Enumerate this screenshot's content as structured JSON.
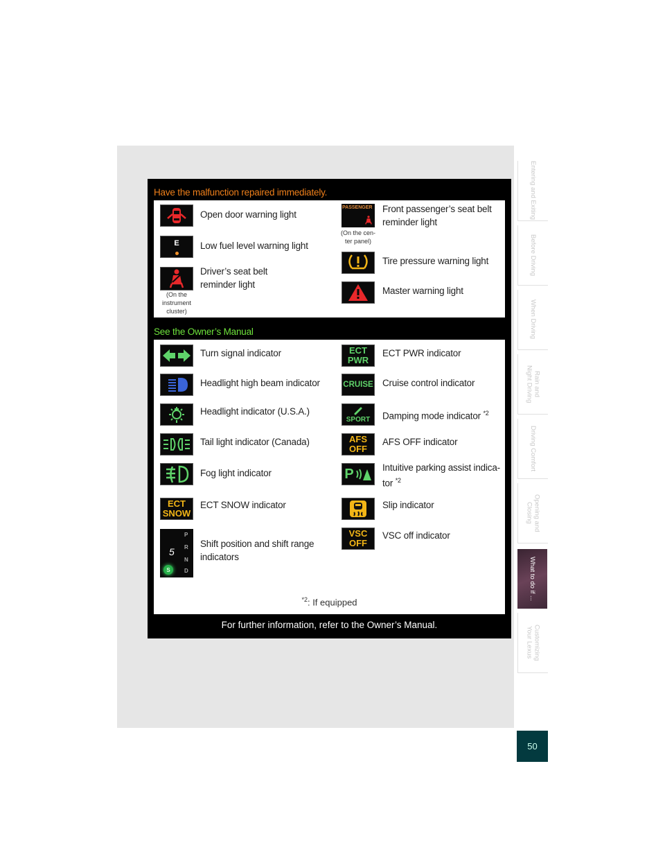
{
  "section1": {
    "title": "Have the malfunction repaired immediately.",
    "title_color": "#ee7f1a",
    "items_left": [
      {
        "icon": "open-door-icon",
        "label": "Open door warning light",
        "color": "#e8282a"
      },
      {
        "icon": "low-fuel-icon",
        "label": "Low fuel level warning light",
        "icon_text": "E",
        "color": "#f0902a"
      },
      {
        "icon": "seat-belt-icon",
        "label_line1": "Driver’s seat belt",
        "label_line2": "reminder light",
        "note_line1": "(On the",
        "note_line2": "instrument",
        "note_line3": "cluster)",
        "color": "#e8282a"
      }
    ],
    "items_right": [
      {
        "icon": "passenger-seat-belt-icon",
        "icon_text": "PASSENGER",
        "label_line1": "Front passenger’s seat belt",
        "label_line2": "reminder light",
        "note_line1": "(On the cen-",
        "note_line2": "ter panel)",
        "color": "#e8282a"
      },
      {
        "icon": "tire-pressure-icon",
        "label": "Tire pressure warning light",
        "color": "#f2b516"
      },
      {
        "icon": "master-warning-icon",
        "label": "Master warning light",
        "color": "#e8282a"
      }
    ]
  },
  "section2": {
    "title": "See the Owner’s Manual",
    "title_color": "#6ee23c",
    "items_left": [
      {
        "icon": "turn-signal-icon",
        "label": "Turn signal indicator"
      },
      {
        "icon": "high-beam-icon",
        "label": "Headlight high beam indicator"
      },
      {
        "icon": "headlight-icon",
        "label": "Headlight indicator (U.S.A.)"
      },
      {
        "icon": "tail-light-icon",
        "label": "Tail light indicator (Canada)"
      },
      {
        "icon": "fog-light-icon",
        "label": "Fog light indicator"
      },
      {
        "icon": "ect-snow-icon",
        "icon_line1": "ECT",
        "icon_line2": "SNOW",
        "label": "ECT SNOW indicator"
      },
      {
        "icon": "shift-position-icon",
        "label_line1": "Shift position and shift range",
        "label_line2": "indicators",
        "gears": [
          "P",
          "R",
          "N",
          "D"
        ],
        "range": "5",
        "mode": "S"
      }
    ],
    "items_right": [
      {
        "icon": "ect-pwr-icon",
        "icon_line1": "ECT",
        "icon_line2": "PWR",
        "label": "ECT PWR indicator"
      },
      {
        "icon": "cruise-icon",
        "icon_text": "CRUISE",
        "label": "Cruise control indicator"
      },
      {
        "icon": "damping-sport-icon",
        "icon_text": "SPORT",
        "label": "Damping mode indicator",
        "sup": "*2"
      },
      {
        "icon": "afs-off-icon",
        "icon_line1": "AFS",
        "icon_line2": "OFF",
        "label": "AFS OFF indicator"
      },
      {
        "icon": "parking-assist-icon",
        "icon_text": "P",
        "label_line1": "Intuitive parking assist indica-",
        "label_line2": "tor",
        "sup": "*2"
      },
      {
        "icon": "slip-icon",
        "label": "Slip indicator"
      },
      {
        "icon": "vsc-off-icon",
        "icon_line1": "VSC",
        "icon_line2": "OFF",
        "label": "VSC off indicator"
      }
    ],
    "footnote_mark": "*2",
    "footnote_text": ": If equipped"
  },
  "footer": "For further information, refer to the Owner’s Manual.",
  "side_tabs": [
    {
      "label": "Entering and Exiting",
      "active": false
    },
    {
      "label": "Before Driving",
      "active": false
    },
    {
      "label": "When Driving",
      "active": false
    },
    {
      "label": "Rain and\nNight Driving",
      "active": false
    },
    {
      "label": "Driving Comfort",
      "active": false
    },
    {
      "label": "Opening and Closing",
      "active": false
    },
    {
      "label": "What to do if ...",
      "active": true
    },
    {
      "label": "Customizing\nYour Lexus",
      "active": false
    }
  ],
  "page_number": "50",
  "colors": {
    "green_icon": "#5fd36a",
    "amber_icon": "#f2b516",
    "blue_icon": "#3a64d8",
    "page_tab": "#033a3f"
  }
}
